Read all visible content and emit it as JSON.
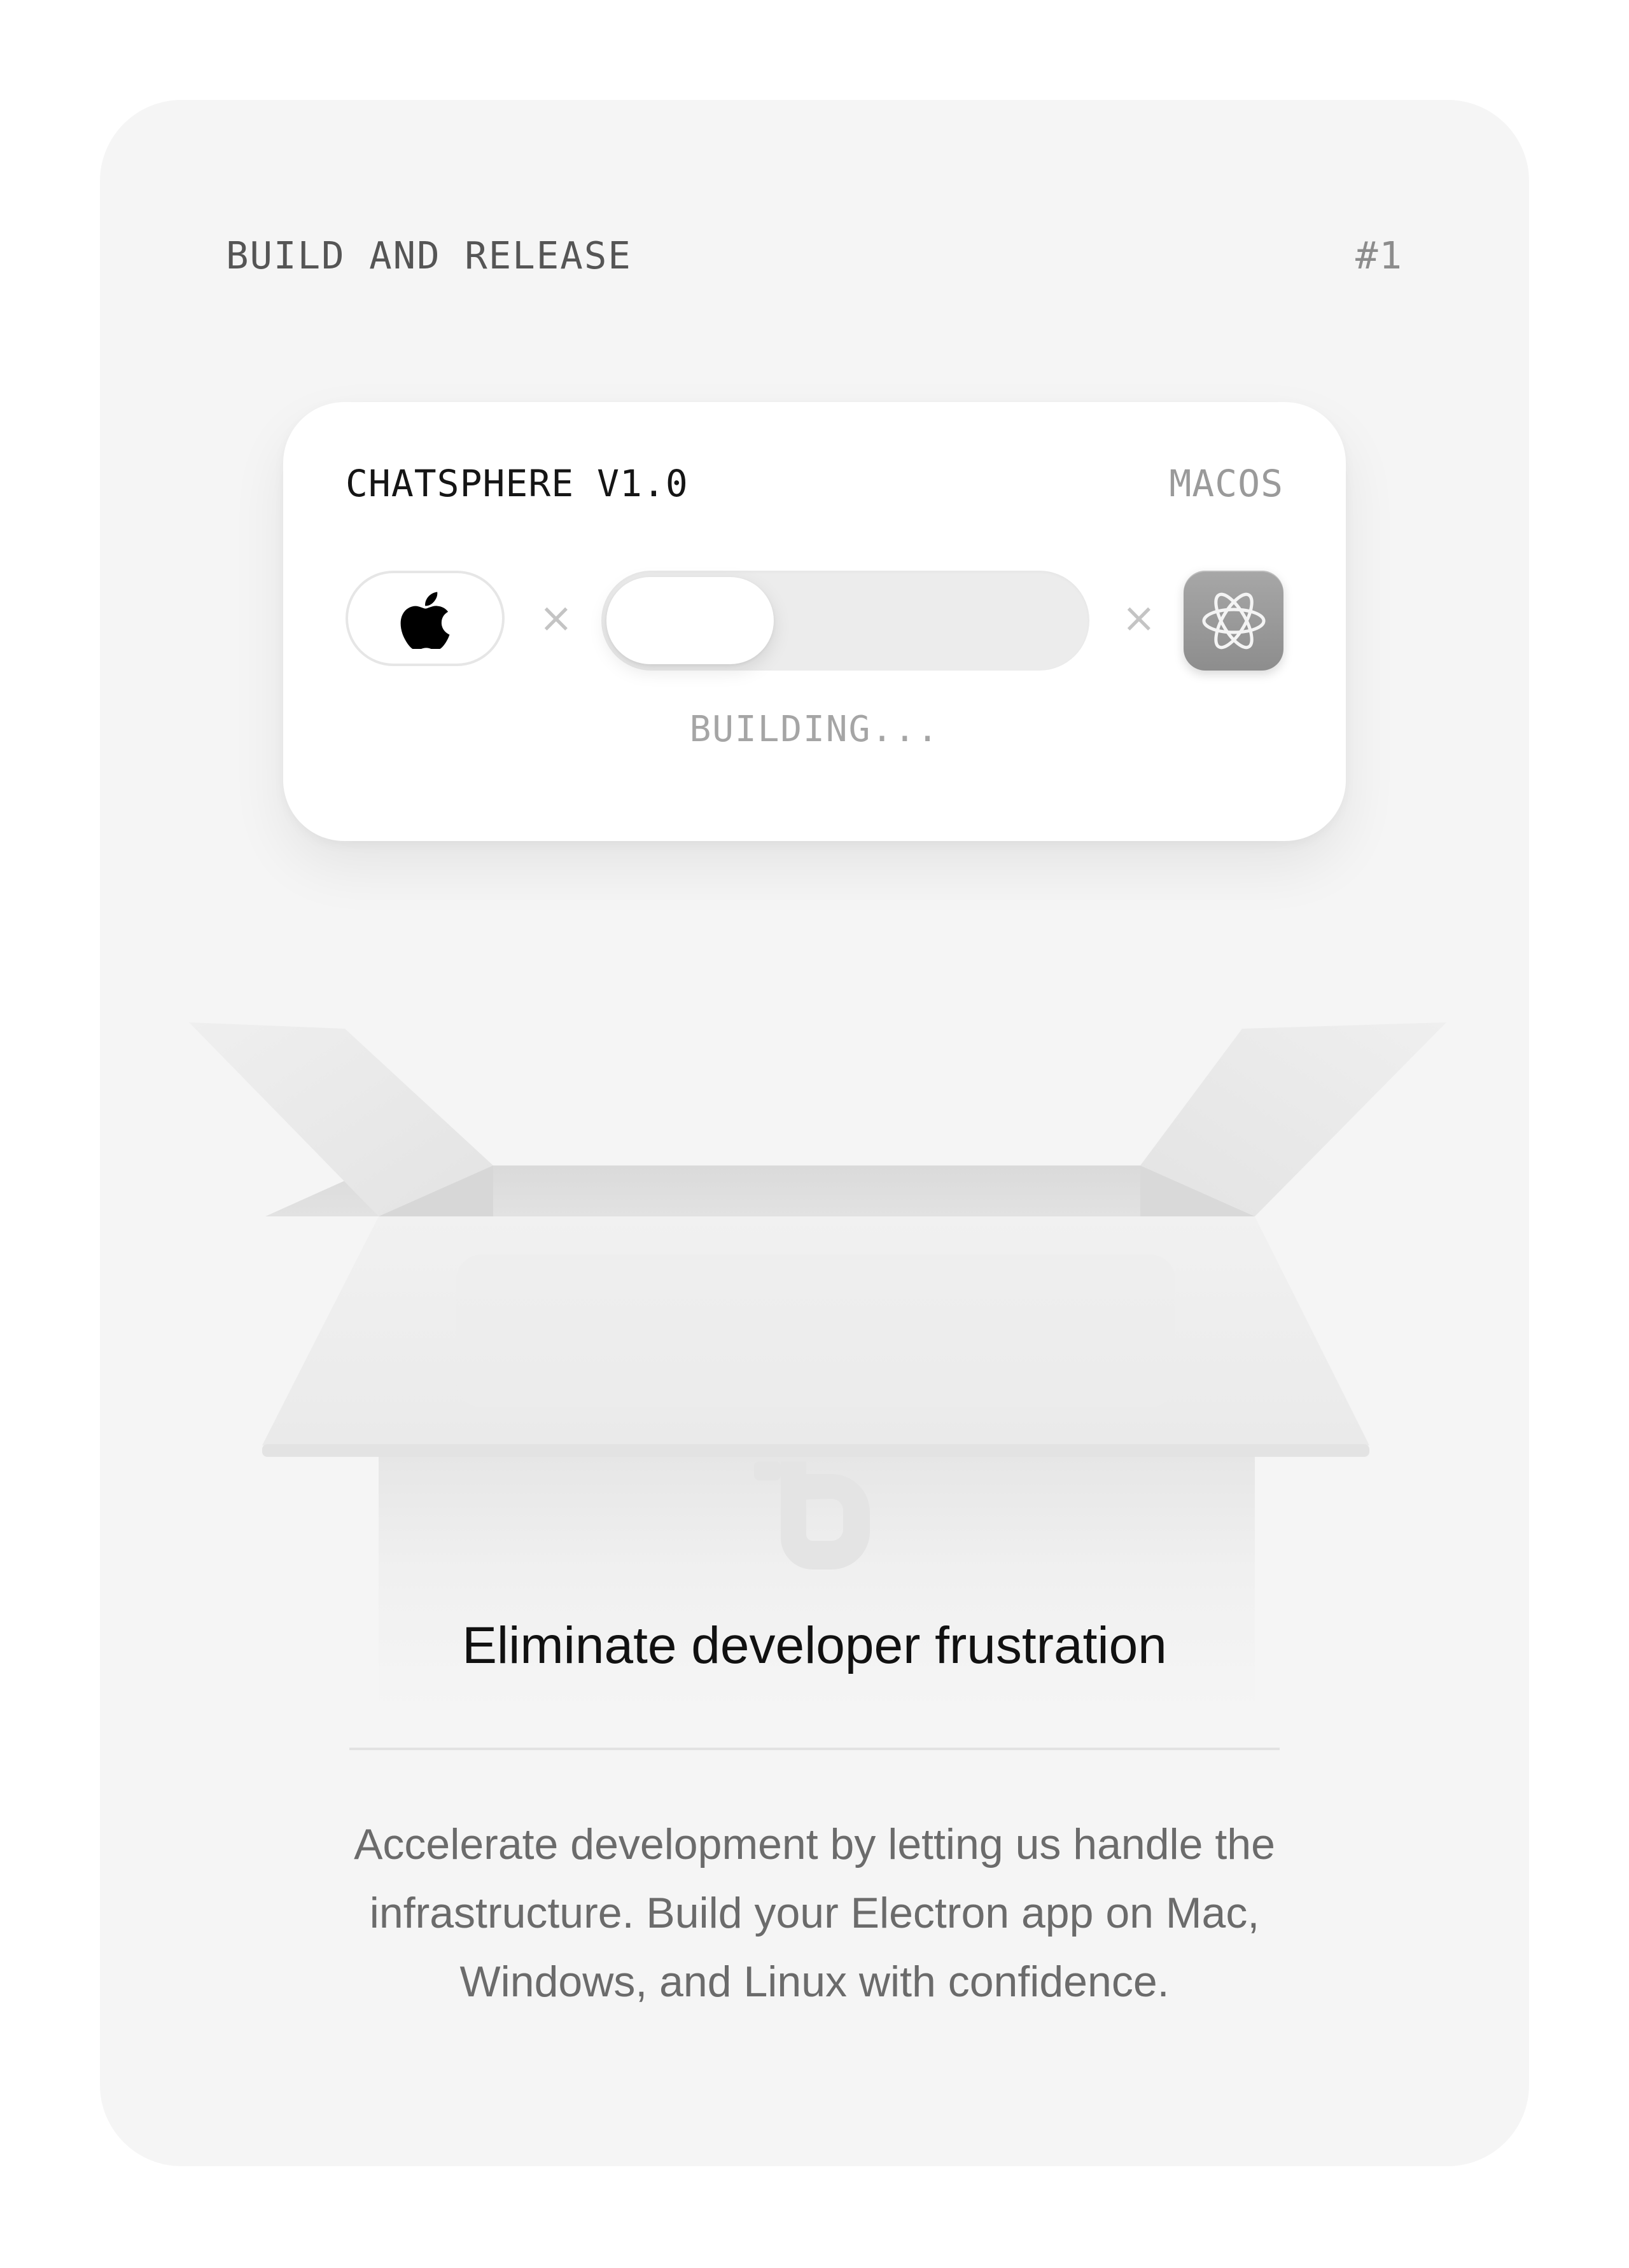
{
  "card": {
    "eyebrow": "BUILD AND RELEASE",
    "index": "#1"
  },
  "build_widget": {
    "app_name": "CHATSPHERE V1.0",
    "platform": "MACOS",
    "os_icon": "apple-icon",
    "separator": "×",
    "progress_percent": 35,
    "app_icon": "electron-atom-icon",
    "status": "BUILDING..."
  },
  "illustration": {
    "icon": "open-box-illustration",
    "logo": "brand-logo-mark"
  },
  "headline": "Eliminate developer frustration",
  "description": "Accelerate development by letting us handle the infrastructure. Build your Electron app on Mac, Windows, and Linux with confidence."
}
